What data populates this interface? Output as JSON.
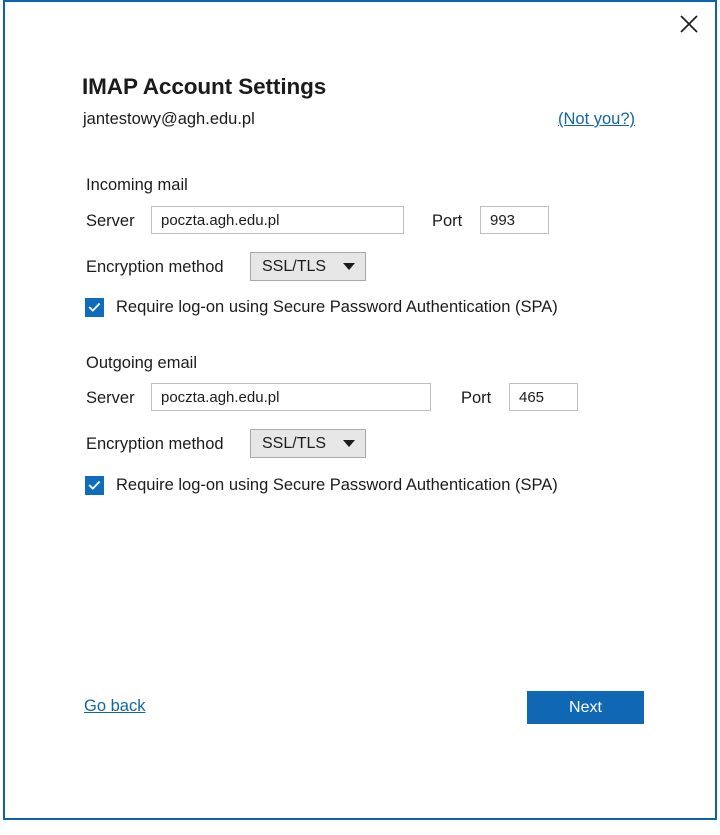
{
  "window": {
    "close_icon": "close-icon",
    "border_color": "#0b63ad"
  },
  "header": {
    "title": "IMAP Account Settings",
    "account_email": "jantestowy@agh.edu.pl",
    "not_you_link": "(Not you?)"
  },
  "incoming": {
    "heading": "Incoming mail",
    "server_label": "Server",
    "server_value": "poczta.agh.edu.pl",
    "port_label": "Port",
    "port_value": "993",
    "encryption_label": "Encryption method",
    "encryption_value": "SSL/TLS",
    "encryption_options": [
      "SSL/TLS"
    ],
    "spa_label": "Require log-on using Secure Password Authentication (SPA)",
    "spa_checked": "checked"
  },
  "outgoing": {
    "heading": "Outgoing email",
    "server_label": "Server",
    "server_value": "poczta.agh.edu.pl",
    "port_label": "Port",
    "port_value": "465",
    "encryption_label": "Encryption method",
    "encryption_value": "SSL/TLS",
    "encryption_options": [
      "SSL/TLS"
    ],
    "spa_label": "Require log-on using Secure Password Authentication (SPA)",
    "spa_checked": "checked"
  },
  "footer": {
    "go_back_label": "Go back",
    "next_label": "Next"
  },
  "colors": {
    "accent": "#0f6cbd",
    "link": "#1264a3",
    "button": "#1068b5",
    "text": "#1b1b1b"
  }
}
